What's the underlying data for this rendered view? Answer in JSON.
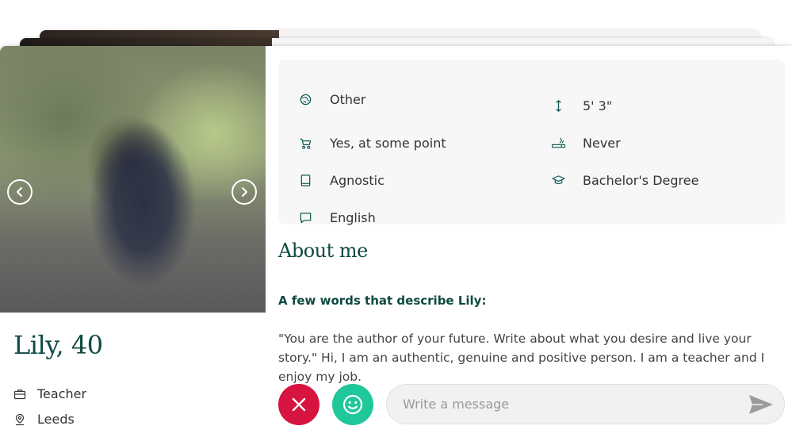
{
  "profile": {
    "name_age": "Lily, 40",
    "job": "Teacher",
    "location": "Leeds"
  },
  "details": {
    "ethnicity": "Other",
    "height": "5' 3\"",
    "children": "Yes, at some point",
    "smoking": "Never",
    "religion": "Agnostic",
    "education": "Bachelor's Degree",
    "language": "English"
  },
  "about": {
    "title": "About me",
    "subtitle": "A few words that describe Lily:",
    "text": "\"You are the author of your future. Write about what you desire and live your story.\" Hi, I am an authentic, genuine and positive person. I am a teacher and I enjoy my job."
  },
  "message": {
    "placeholder": "Write a message"
  },
  "colors": {
    "brand_green": "#0e4a42",
    "reject_red": "#d7133f",
    "like_green": "#1fc79a"
  },
  "icons": {
    "ethnicity": "globe-icon",
    "height": "height-arrows-icon",
    "children": "stroller-icon",
    "smoking": "smoking-icon",
    "religion": "book-icon",
    "education": "graduation-cap-icon",
    "language": "speech-bubble-icon",
    "job": "briefcase-icon",
    "location": "location-pin-icon"
  }
}
